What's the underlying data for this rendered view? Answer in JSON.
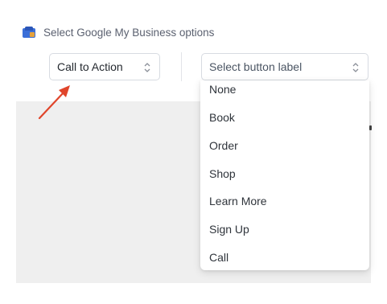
{
  "header": {
    "icon": "google-my-business-icon",
    "text": "Select Google My Business options"
  },
  "cta_select": {
    "value": "Call to Action",
    "icon": "chevron-updown-icon"
  },
  "label_select": {
    "placeholder": "Select button label",
    "icon": "chevron-updown-icon"
  },
  "dropdown": {
    "options": [
      "None",
      "Book",
      "Order",
      "Shop",
      "Learn More",
      "Sign Up",
      "Call"
    ]
  },
  "annotation": {
    "arrow_color": "#e0452b"
  }
}
